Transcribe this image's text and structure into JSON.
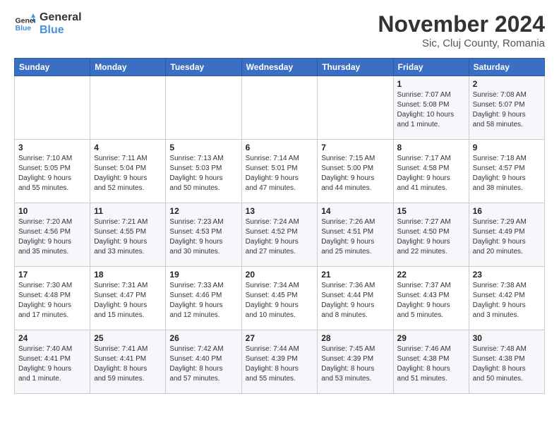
{
  "logo": {
    "line1": "General",
    "line2": "Blue"
  },
  "title": "November 2024",
  "location": "Sic, Cluj County, Romania",
  "weekdays": [
    "Sunday",
    "Monday",
    "Tuesday",
    "Wednesday",
    "Thursday",
    "Friday",
    "Saturday"
  ],
  "weeks": [
    [
      {
        "day": "",
        "info": ""
      },
      {
        "day": "",
        "info": ""
      },
      {
        "day": "",
        "info": ""
      },
      {
        "day": "",
        "info": ""
      },
      {
        "day": "",
        "info": ""
      },
      {
        "day": "1",
        "info": "Sunrise: 7:07 AM\nSunset: 5:08 PM\nDaylight: 10 hours\nand 1 minute."
      },
      {
        "day": "2",
        "info": "Sunrise: 7:08 AM\nSunset: 5:07 PM\nDaylight: 9 hours\nand 58 minutes."
      }
    ],
    [
      {
        "day": "3",
        "info": "Sunrise: 7:10 AM\nSunset: 5:05 PM\nDaylight: 9 hours\nand 55 minutes."
      },
      {
        "day": "4",
        "info": "Sunrise: 7:11 AM\nSunset: 5:04 PM\nDaylight: 9 hours\nand 52 minutes."
      },
      {
        "day": "5",
        "info": "Sunrise: 7:13 AM\nSunset: 5:03 PM\nDaylight: 9 hours\nand 50 minutes."
      },
      {
        "day": "6",
        "info": "Sunrise: 7:14 AM\nSunset: 5:01 PM\nDaylight: 9 hours\nand 47 minutes."
      },
      {
        "day": "7",
        "info": "Sunrise: 7:15 AM\nSunset: 5:00 PM\nDaylight: 9 hours\nand 44 minutes."
      },
      {
        "day": "8",
        "info": "Sunrise: 7:17 AM\nSunset: 4:58 PM\nDaylight: 9 hours\nand 41 minutes."
      },
      {
        "day": "9",
        "info": "Sunrise: 7:18 AM\nSunset: 4:57 PM\nDaylight: 9 hours\nand 38 minutes."
      }
    ],
    [
      {
        "day": "10",
        "info": "Sunrise: 7:20 AM\nSunset: 4:56 PM\nDaylight: 9 hours\nand 35 minutes."
      },
      {
        "day": "11",
        "info": "Sunrise: 7:21 AM\nSunset: 4:55 PM\nDaylight: 9 hours\nand 33 minutes."
      },
      {
        "day": "12",
        "info": "Sunrise: 7:23 AM\nSunset: 4:53 PM\nDaylight: 9 hours\nand 30 minutes."
      },
      {
        "day": "13",
        "info": "Sunrise: 7:24 AM\nSunset: 4:52 PM\nDaylight: 9 hours\nand 27 minutes."
      },
      {
        "day": "14",
        "info": "Sunrise: 7:26 AM\nSunset: 4:51 PM\nDaylight: 9 hours\nand 25 minutes."
      },
      {
        "day": "15",
        "info": "Sunrise: 7:27 AM\nSunset: 4:50 PM\nDaylight: 9 hours\nand 22 minutes."
      },
      {
        "day": "16",
        "info": "Sunrise: 7:29 AM\nSunset: 4:49 PM\nDaylight: 9 hours\nand 20 minutes."
      }
    ],
    [
      {
        "day": "17",
        "info": "Sunrise: 7:30 AM\nSunset: 4:48 PM\nDaylight: 9 hours\nand 17 minutes."
      },
      {
        "day": "18",
        "info": "Sunrise: 7:31 AM\nSunset: 4:47 PM\nDaylight: 9 hours\nand 15 minutes."
      },
      {
        "day": "19",
        "info": "Sunrise: 7:33 AM\nSunset: 4:46 PM\nDaylight: 9 hours\nand 12 minutes."
      },
      {
        "day": "20",
        "info": "Sunrise: 7:34 AM\nSunset: 4:45 PM\nDaylight: 9 hours\nand 10 minutes."
      },
      {
        "day": "21",
        "info": "Sunrise: 7:36 AM\nSunset: 4:44 PM\nDaylight: 9 hours\nand 8 minutes."
      },
      {
        "day": "22",
        "info": "Sunrise: 7:37 AM\nSunset: 4:43 PM\nDaylight: 9 hours\nand 5 minutes."
      },
      {
        "day": "23",
        "info": "Sunrise: 7:38 AM\nSunset: 4:42 PM\nDaylight: 9 hours\nand 3 minutes."
      }
    ],
    [
      {
        "day": "24",
        "info": "Sunrise: 7:40 AM\nSunset: 4:41 PM\nDaylight: 9 hours\nand 1 minute."
      },
      {
        "day": "25",
        "info": "Sunrise: 7:41 AM\nSunset: 4:41 PM\nDaylight: 8 hours\nand 59 minutes."
      },
      {
        "day": "26",
        "info": "Sunrise: 7:42 AM\nSunset: 4:40 PM\nDaylight: 8 hours\nand 57 minutes."
      },
      {
        "day": "27",
        "info": "Sunrise: 7:44 AM\nSunset: 4:39 PM\nDaylight: 8 hours\nand 55 minutes."
      },
      {
        "day": "28",
        "info": "Sunrise: 7:45 AM\nSunset: 4:39 PM\nDaylight: 8 hours\nand 53 minutes."
      },
      {
        "day": "29",
        "info": "Sunrise: 7:46 AM\nSunset: 4:38 PM\nDaylight: 8 hours\nand 51 minutes."
      },
      {
        "day": "30",
        "info": "Sunrise: 7:48 AM\nSunset: 4:38 PM\nDaylight: 8 hours\nand 50 minutes."
      }
    ]
  ]
}
